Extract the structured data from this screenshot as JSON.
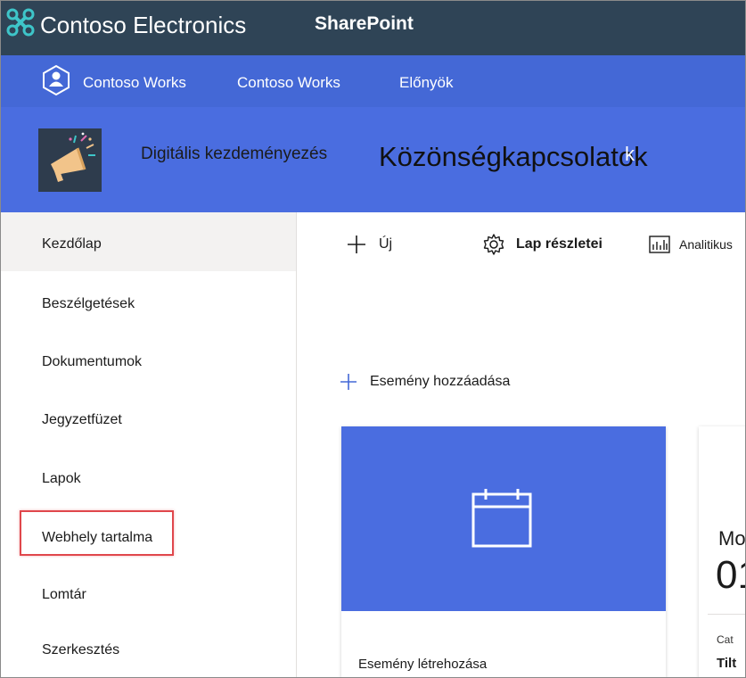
{
  "suite": {
    "brand": "Contoso Electronics",
    "app": "SharePoint",
    "brand_logo_icon": "contoso-logo-icon"
  },
  "hub": {
    "logo_icon": "contoso-works-logo-icon",
    "links": [
      "Contoso Works",
      "Contoso Works",
      "Előnyök"
    ]
  },
  "site": {
    "logo_icon": "megaphone-icon",
    "title_small": "Digitális kezdeményezés",
    "title_large": "Közönségkapcsolatok",
    "title_suffix": "k"
  },
  "leftnav": {
    "items": [
      {
        "label": "Kezdőlap",
        "active": true
      },
      {
        "label": "Beszélgetések",
        "active": false
      },
      {
        "label": "Dokumentumok",
        "active": false
      },
      {
        "label": "Jegyzetfüzet",
        "active": false
      },
      {
        "label": "Lapok",
        "active": false
      },
      {
        "label": "Webhely tartalma",
        "active": false,
        "highlighted": true
      },
      {
        "label": "Lomtár",
        "active": false
      },
      {
        "label": "Szerkesztés",
        "active": false
      }
    ]
  },
  "commandbar": {
    "new_label": "Új",
    "page_details_label": "Lap részletei",
    "analytics_label": "Analitikus"
  },
  "events": {
    "add_label": "Esemény hozzáadása",
    "card_title": "Esemény létrehozása",
    "side_card": {
      "month": "Mo",
      "day": "01",
      "category": "Cat",
      "title": "Tilt"
    }
  },
  "colors": {
    "suitebar": "#2f4456",
    "hubnav": "#4468d6",
    "siteheader": "#4a6de0",
    "highlight": "#e0474c",
    "accent_teal": "#3ec5c9"
  }
}
